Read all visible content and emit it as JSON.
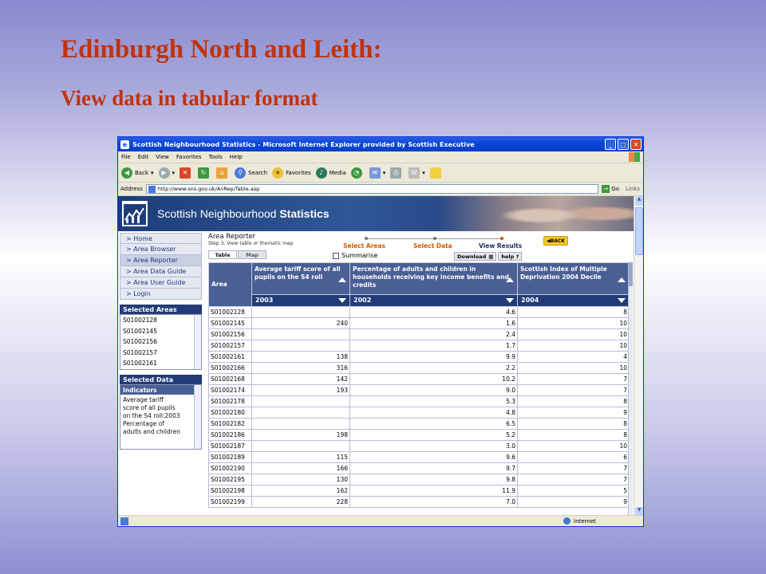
{
  "slide": {
    "title": "Edinburgh North and Leith:",
    "subtitle": "View data in tabular format"
  },
  "browser": {
    "title": "Scottish Neighbourhood Statistics - Microsoft Internet Explorer provided by Scottish Executive",
    "menu": [
      "File",
      "Edit",
      "View",
      "Favorites",
      "Tools",
      "Help"
    ],
    "toolbar": {
      "back": "Back",
      "search": "Search",
      "favorites": "Favorites",
      "media": "Media"
    },
    "address_label": "Address",
    "address_value": "http://www.sns.gov.uk/AnRep/Table.asp",
    "go_label": "Go",
    "links_label": "Links",
    "status_zone": "Internet"
  },
  "site": {
    "brand_plain": "Scottish Neighbourhood ",
    "brand_bold": "Statistics",
    "nav": [
      "> Home",
      "> Area Browser",
      "> Area Reporter",
      "> Area Data Guide",
      "> Area User Guide",
      "> Login"
    ],
    "selected_areas_title": "Selected Areas",
    "selected_areas": [
      "S01002128",
      "S01002145",
      "S01002156",
      "S01002157",
      "S01002161"
    ],
    "selected_data_title": "Selected Data",
    "indicators_title": "Indicators",
    "indicator_lines": [
      "Average tariff",
      "score of all pupils",
      "on the S4 roll:2003",
      "Percentage of",
      "adults and children"
    ]
  },
  "reporter": {
    "title": "Area Reporter",
    "step": "Step 3. View table or thematic map",
    "steps": [
      "Select Areas",
      "Select Data",
      "View Results"
    ],
    "back": "BACK",
    "tabs": [
      "Table",
      "Map"
    ],
    "summarise": "Summarise",
    "download": "Download",
    "help": "help ?"
  },
  "table": {
    "area_header": "Area",
    "columns": [
      {
        "header": "Average tariff score of all pupils on the S4 roll",
        "year": "2003"
      },
      {
        "header": "Percentage of adults and children in households receiving key income benefits and credits",
        "year": "2002"
      },
      {
        "header": "Scottish Index of Multiple Deprivation 2004 Decile",
        "year": "2004"
      }
    ],
    "rows": [
      [
        "S01002128",
        "",
        "4.6",
        "8"
      ],
      [
        "S01002145",
        "240",
        "1.6",
        "10"
      ],
      [
        "S01002156",
        "",
        "2.4",
        "10"
      ],
      [
        "S01002157",
        "",
        "1.7",
        "10"
      ],
      [
        "S01002161",
        "138",
        "9.9",
        "4"
      ],
      [
        "S01002166",
        "316",
        "2.2",
        "10"
      ],
      [
        "S01002168",
        "142",
        "10.2",
        "7"
      ],
      [
        "S01002174",
        "193",
        "9.0",
        "7"
      ],
      [
        "S01002178",
        "",
        "5.3",
        "8"
      ],
      [
        "S01002180",
        "",
        "4.8",
        "9"
      ],
      [
        "S01002182",
        "",
        "6.5",
        "8"
      ],
      [
        "S01002186",
        "198",
        "5.2",
        "8"
      ],
      [
        "S01002187",
        "",
        "3.0",
        "10"
      ],
      [
        "S01002189",
        "115",
        "9.6",
        "6"
      ],
      [
        "S01002190",
        "166",
        "9.7",
        "7"
      ],
      [
        "S01002195",
        "130",
        "9.8",
        "7"
      ],
      [
        "S01002198",
        "162",
        "11.9",
        "5"
      ],
      [
        "S01002199",
        "228",
        "7.0",
        "9"
      ]
    ]
  }
}
